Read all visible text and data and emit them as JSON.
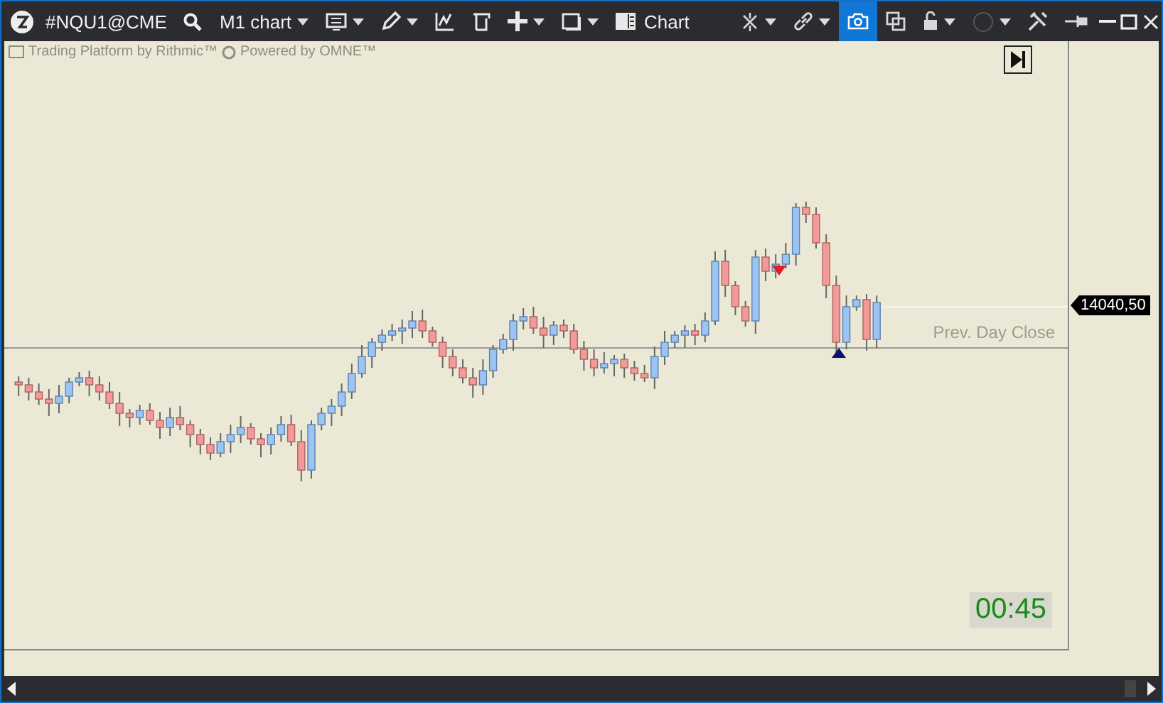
{
  "window": {
    "title": "Chart"
  },
  "toolbar": {
    "symbol": "#NQU1@CME",
    "timeframe": "M1 chart",
    "left_tools": [
      {
        "has_menu": true
      },
      {
        "has_menu": true
      },
      {
        "has_menu": false
      },
      {
        "has_menu": false
      },
      {
        "has_menu": true
      },
      {
        "has_menu": true
      },
      {
        "has_menu": false
      }
    ],
    "right_tools": [
      {
        "has_menu": true,
        "selected": false
      },
      {
        "has_menu": true,
        "selected": false
      },
      {
        "has_menu": false,
        "selected": true
      },
      {
        "has_menu": false,
        "selected": false
      },
      {
        "has_menu": true,
        "selected": false
      },
      {
        "has_menu": true,
        "selected": false
      },
      {
        "has_menu": false,
        "selected": false
      },
      {
        "has_menu": false,
        "selected": false
      }
    ]
  },
  "chart": {
    "branding": [
      "Trading Platform by Rithmic™",
      "Powered by OMNE™"
    ],
    "prev_close_label": "Prev. Day Close",
    "price_label": "14040,50",
    "timer": "00:45"
  }
}
